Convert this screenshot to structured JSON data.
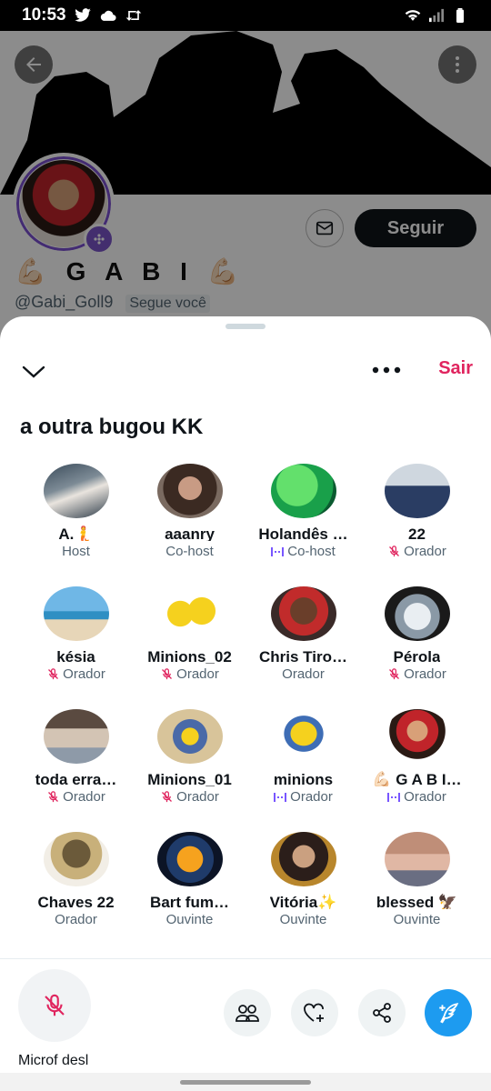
{
  "status_bar": {
    "time": "10:53"
  },
  "profile": {
    "name": "💪🏻 G A B I 💪🏻",
    "handle": "@Gabi_Goll9",
    "follows_you": "Segue você",
    "follow_label": "Seguir"
  },
  "space": {
    "title": "a outra bugou KK",
    "leave_label": "Sair",
    "participants": [
      {
        "name": "A.🧜",
        "role": "Host",
        "indicator": "none"
      },
      {
        "name": "aaanry ",
        "role": "Co-host",
        "indicator": "none"
      },
      {
        "name": "Holandês …",
        "role": "Co-host",
        "indicator": "speaking"
      },
      {
        "name": "22 ",
        "role": "Orador",
        "indicator": "muted"
      },
      {
        "name": "késia",
        "role": "Orador",
        "indicator": "muted"
      },
      {
        "name": "Minions_02",
        "role": "Orador",
        "indicator": "muted"
      },
      {
        "name": "Chris Tiro…",
        "role": "Orador",
        "indicator": "none"
      },
      {
        "name": "Pérola",
        "role": "Orador",
        "indicator": "muted"
      },
      {
        "name": "toda erra…",
        "role": "Orador",
        "indicator": "muted"
      },
      {
        "name": "Minions_01",
        "role": "Orador",
        "indicator": "muted"
      },
      {
        "name": "minions",
        "role": "Orador",
        "indicator": "speaking"
      },
      {
        "name": "💪🏻 G A B I…",
        "role": "Orador",
        "indicator": "speaking"
      },
      {
        "name": "Chaves 22",
        "role": "Orador",
        "indicator": "none"
      },
      {
        "name": "Bart fum…",
        "role": "Ouvinte",
        "indicator": "none"
      },
      {
        "name": "Vitória✨",
        "role": "Ouvinte",
        "indicator": "none"
      },
      {
        "name": "blessed 🦅",
        "role": "Ouvinte",
        "indicator": "none"
      }
    ],
    "mic_label": "Microf desl"
  },
  "colors": {
    "accent_red": "#e0245e",
    "accent_blue": "#1d9bf0",
    "speaking_purple": "#7856ff",
    "text_dark": "#0f1419",
    "text_muted": "#536471"
  },
  "icons": [
    "twitter-icon",
    "cloud-icon",
    "retweet-icon",
    "wifi-icon",
    "signal-icon",
    "battery-icon",
    "back-arrow-icon",
    "more-vertical-icon",
    "mail-icon",
    "chevron-down-icon",
    "more-horizontal-icon",
    "mic-off-icon",
    "speaking-bars-icon",
    "people-icon",
    "heart-plus-icon",
    "share-icon",
    "compose-icon"
  ]
}
